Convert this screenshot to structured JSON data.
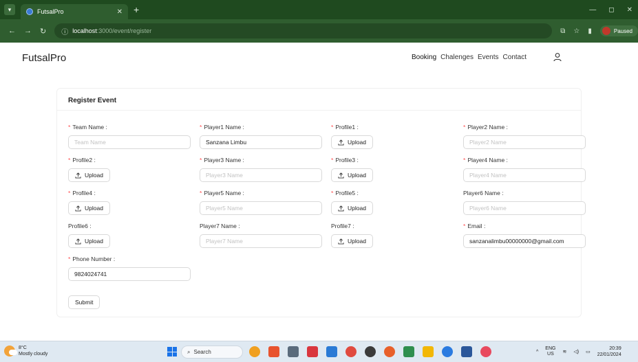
{
  "browser": {
    "tab_title": "FutsalPro",
    "url_host": "localhost",
    "url_path": ":3000/event/register",
    "profile_status": "Paused"
  },
  "header": {
    "logo": "FutsalPro",
    "nav": [
      "Booking",
      "Chalenges",
      "Events",
      "Contact"
    ]
  },
  "form": {
    "title": "Register Event",
    "upload_label": "Upload",
    "submit_label": "Submit",
    "fields": {
      "team_name": {
        "label": "Team Name",
        "placeholder": "Team Name",
        "value": ""
      },
      "player1_name": {
        "label": "Player1 Name",
        "placeholder": "Player1 Name",
        "value": "Sanzana Limbu"
      },
      "profile1": {
        "label": "Profile1"
      },
      "player2_name": {
        "label": "Player2 Name",
        "placeholder": "Player2 Name",
        "value": ""
      },
      "profile2": {
        "label": "Profile2"
      },
      "player3_name": {
        "label": "Player3 Name",
        "placeholder": "Player3 Name",
        "value": ""
      },
      "profile3": {
        "label": "Profile3"
      },
      "player4_name": {
        "label": "Player4 Name",
        "placeholder": "Player4 Name",
        "value": ""
      },
      "profile4": {
        "label": "Profile4"
      },
      "player5_name": {
        "label": "Player5 Name",
        "placeholder": "Player5 Name",
        "value": ""
      },
      "profile5": {
        "label": "Profile5"
      },
      "player6_name": {
        "label": "Player6 Name",
        "placeholder": "Player6 Name",
        "value": ""
      },
      "profile6": {
        "label": "Profile6"
      },
      "player7_name": {
        "label": "Player7 Name",
        "placeholder": "Player7 Name",
        "value": ""
      },
      "profile7": {
        "label": "Profile7"
      },
      "email": {
        "label": "Email",
        "placeholder": "",
        "value": "sanzanalimbu00000000@gmail.com"
      },
      "phone": {
        "label": "Phone Number",
        "placeholder": "",
        "value": "9824024741"
      }
    }
  },
  "taskbar": {
    "temp": "8°C",
    "weather": "Mostly cloudy",
    "search": "Search",
    "lang": "ENG",
    "region": "US",
    "time": "20:39",
    "date": "22/01/2024"
  },
  "colors": {
    "chrome": "#2f5d2f",
    "required": "#ff4d4f",
    "accent": "#1a73e8"
  }
}
